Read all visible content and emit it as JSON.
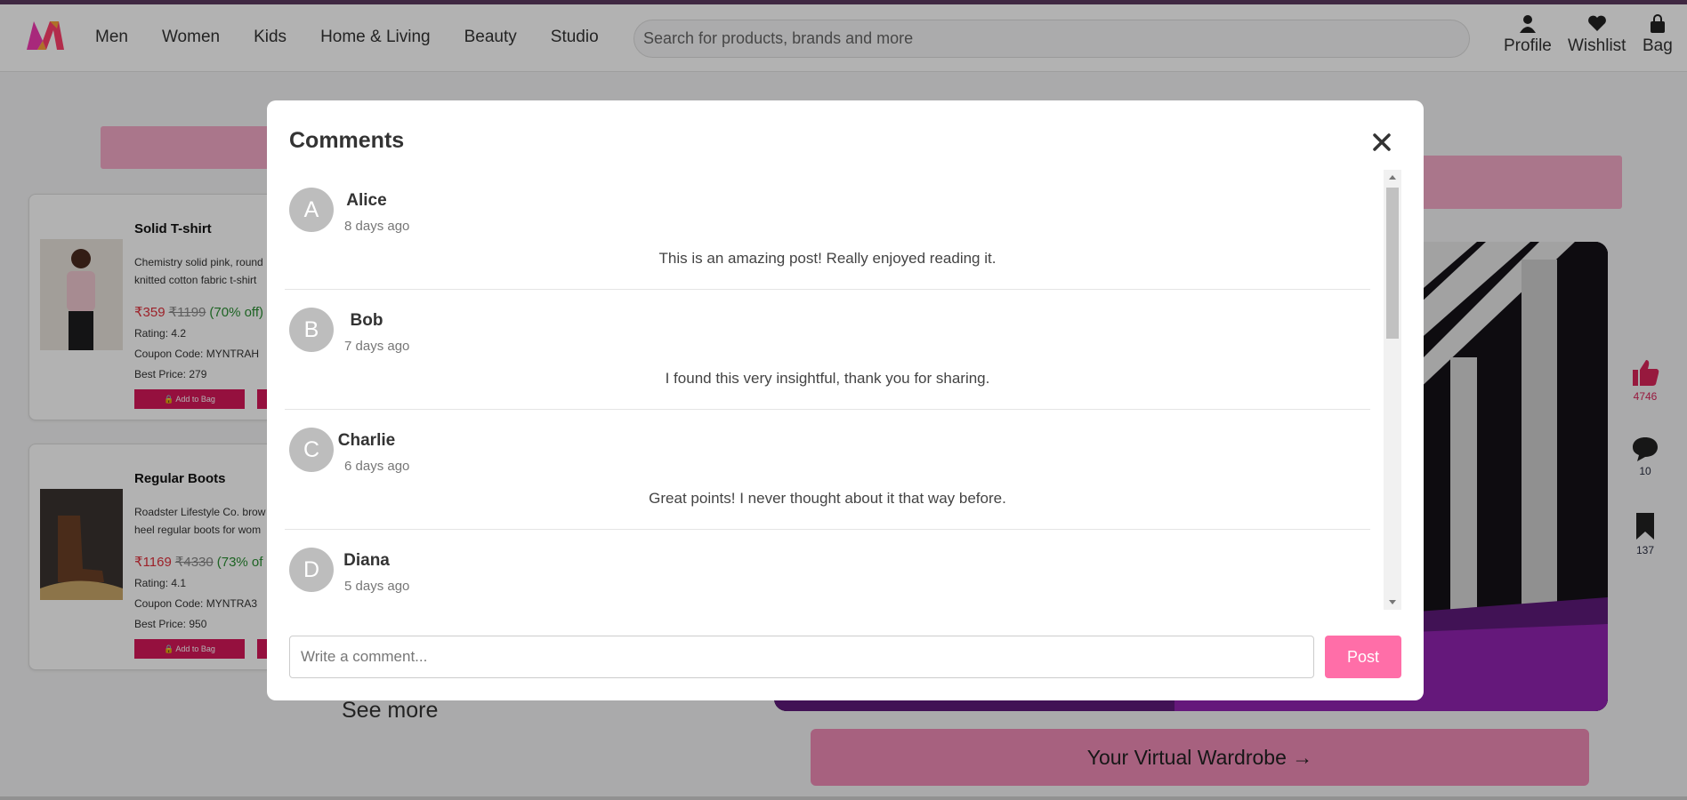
{
  "header": {
    "nav": [
      "Men",
      "Women",
      "Kids",
      "Home & Living",
      "Beauty",
      "Studio"
    ],
    "search_placeholder": "Search for products, brands and more",
    "actions": [
      {
        "label": "Profile",
        "icon": "profile-icon"
      },
      {
        "label": "Wishlist",
        "icon": "heart-icon"
      },
      {
        "label": "Bag",
        "icon": "bag-icon"
      }
    ]
  },
  "products": [
    {
      "title": "Solid T-shirt",
      "desc_line1": "Chemistry solid pink, round",
      "desc_line2": "knitted cotton fabric t-shirt",
      "price": "₹359",
      "original_price": "₹1199",
      "discount": "(70% off)",
      "rating": "Rating: 4.2",
      "coupon": "Coupon Code: MYNTRAH",
      "best_price": "Best Price: 279",
      "add_to_bag": "Add to Bag"
    },
    {
      "title": "Regular Boots",
      "desc_line1": "Roadster Lifestyle Co. brow",
      "desc_line2": "heel regular boots for wom",
      "price": "₹1169",
      "original_price": "₹4330",
      "discount": "(73% of",
      "rating": "Rating: 4.1",
      "coupon": "Coupon Code: MYNTRA3",
      "best_price": "Best Price: 950",
      "add_to_bag": "Add to Bag"
    }
  ],
  "see_more": "See more",
  "wardrobe_button": "Your Virtual Wardrobe →",
  "side_actions": {
    "likes": "4746",
    "comments": "10",
    "saves": "137"
  },
  "modal": {
    "title": "Comments",
    "comments": [
      {
        "initial": "A",
        "name": "Alice",
        "time": "8 days ago",
        "text": "This is an amazing post! Really enjoyed reading it."
      },
      {
        "initial": "B",
        "name": "Bob",
        "time": "7 days ago",
        "text": "I found this very insightful, thank you for sharing."
      },
      {
        "initial": "C",
        "name": "Charlie",
        "time": "6 days ago",
        "text": "Great points! I never thought about it that way before."
      },
      {
        "initial": "D",
        "name": "Diana",
        "time": "5 days ago",
        "text": ""
      }
    ],
    "input_placeholder": "Write a comment...",
    "post_label": "Post"
  },
  "colors": {
    "brand_pink": "#ff6ea8",
    "accent_red": "#d6175a",
    "overlay": "rgba(0,0,0,0.3)"
  }
}
